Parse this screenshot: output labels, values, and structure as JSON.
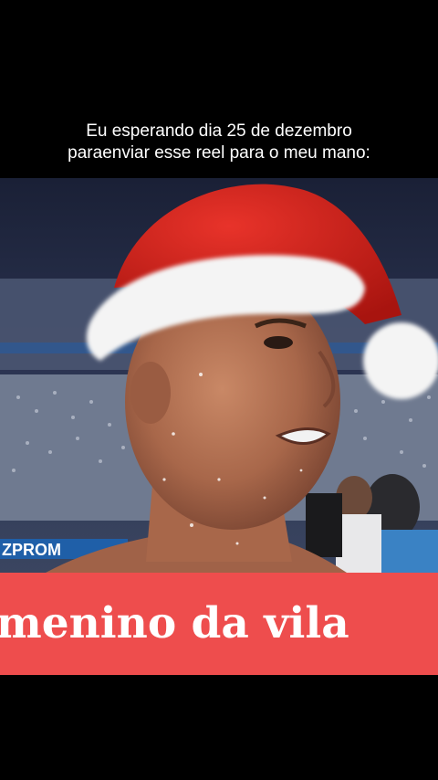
{
  "caption": {
    "line1": "Eu esperando dia 25 de dezembro",
    "line2": "paraenviar esse reel para o meu mano:"
  },
  "photo": {
    "stadium_board_text": "ZPROM",
    "description_icon": "santa-hat-icon"
  },
  "banner": {
    "text": "menino da vila",
    "color": "#ee4d4d"
  },
  "colors": {
    "background": "#000000",
    "caption_text": "#ffffff",
    "hat_red": "#d0201c",
    "hat_white": "#f4f4f4"
  }
}
